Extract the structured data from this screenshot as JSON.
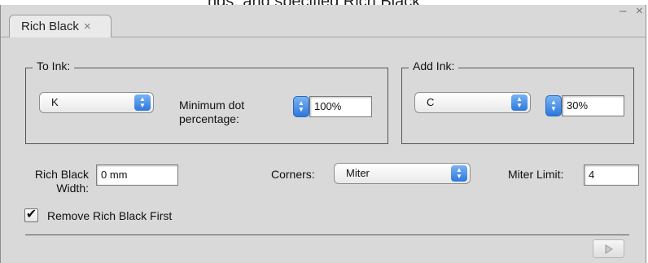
{
  "top_text": "ngs, and specified Rich Black",
  "window_controls": {
    "minimize": "–",
    "close": "×"
  },
  "tab": {
    "label": "Rich Black",
    "close": "×"
  },
  "to_ink": {
    "legend": "To Ink:",
    "ink_value": "K",
    "min_dot_label_line1": "Minimum dot",
    "min_dot_label_line2": "percentage:",
    "min_dot_value": "100%"
  },
  "add_ink": {
    "legend": "Add Ink:",
    "ink_value": "C",
    "percent_value": "30%"
  },
  "rich_black_width": {
    "label_line1": "Rich Black",
    "label_line2": "Width:",
    "value": "0 mm"
  },
  "corners": {
    "label": "Corners:",
    "value": "Miter"
  },
  "miter_limit": {
    "label": "Miter Limit:",
    "value": "4"
  },
  "remove_first": {
    "label": "Remove Rich Black First",
    "checked": true,
    "mark": "✔"
  },
  "colors": {
    "panel": "#d9d9d9",
    "accent": "#2d78dd"
  }
}
